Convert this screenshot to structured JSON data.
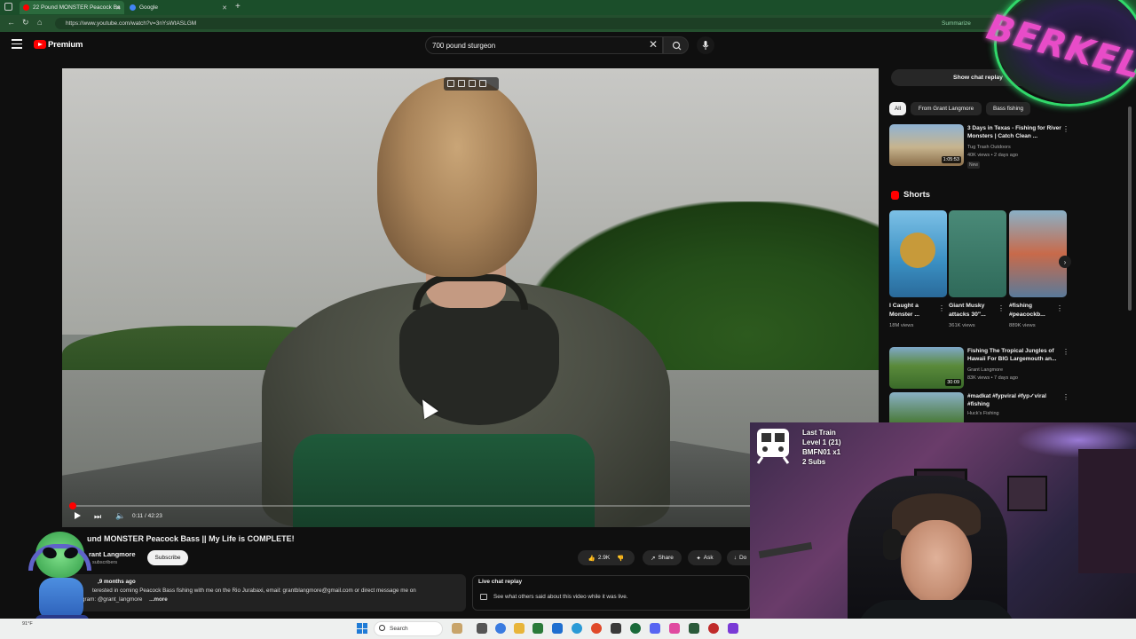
{
  "browser": {
    "tabs": [
      {
        "label": "22 Pound MONSTER Peacock Ba",
        "active": true,
        "favicon_color": "#ff0000"
      },
      {
        "label": "Google",
        "active": false,
        "favicon_color": "#4285f4"
      }
    ],
    "url": "https://www.youtube.com/watch?v=3nYsWtASLGM",
    "summarize_label": "Summarize"
  },
  "masthead": {
    "brand": "Premium",
    "search_value": "700 pound sturgeon",
    "icons": [
      "menu-icon",
      "youtube-logo-icon",
      "close-icon",
      "search-icon",
      "mic-icon"
    ]
  },
  "player": {
    "time": "0:11 / 42:23",
    "progress_fraction": 0.004,
    "controls": [
      "play-icon",
      "next-icon",
      "volume-icon"
    ]
  },
  "video": {
    "title": "und MONSTER Peacock Bass || My Life is COMPLETE!",
    "channel": "rant Langmore",
    "subscribers": "subscribers",
    "subscribe_label": "Subscribe",
    "likes": "2.9K",
    "share_label": "Share",
    "ask_label": "Ask",
    "download_label": "Do",
    "description": {
      "meta": ",9 months ago",
      "line1": "terested in coming Peacock Bass fishing with me on the Rio Jurabaxi, email: grantblangmore@gmail.com or direct message me on",
      "line2": "gram: @grant_langmore",
      "more": "...more"
    }
  },
  "live_chat": {
    "title": "Live chat replay",
    "subtitle": "See what others said about this video while it was live."
  },
  "sidebar": {
    "show_chat_label": "Show chat replay",
    "chips": [
      "All",
      "From Grant Langmore",
      "Bass fishing"
    ],
    "recommendations": [
      {
        "title": "3 Days in Texas - Fishing for River Monsters | Catch Clean ...",
        "channel": "Tug Trash Outdoors",
        "meta": "40K views • 2 days ago",
        "badge": "New",
        "duration": "1:05:53"
      },
      {
        "title": "Fishing The Tropical Jungles of Hawaii For BIG Largemouth an...",
        "channel": "Grant Langmore",
        "meta": "83K views • 7 days ago",
        "duration": "30:09"
      },
      {
        "title": "#madkat #fypviral #fyp✓viral #fishing",
        "channel": "Huck's Fishing",
        "meta": ""
      }
    ],
    "shorts_label": "Shorts",
    "shorts": [
      {
        "title": "I Caught a Monster ...",
        "views": "18M views"
      },
      {
        "title": "Giant Musky attacks 30\"...",
        "views": "361K views"
      },
      {
        "title": "#fishing #peacockb...",
        "views": "889K views"
      }
    ]
  },
  "stream_overlay": {
    "train": {
      "title": "Last Train",
      "level": "Level 1  (21)",
      "code": "BMFN01 x1",
      "subs": "2 Subs"
    },
    "logo_text": "BERKEL"
  },
  "taskbar": {
    "search_placeholder": "Search",
    "weather": "91°F"
  }
}
